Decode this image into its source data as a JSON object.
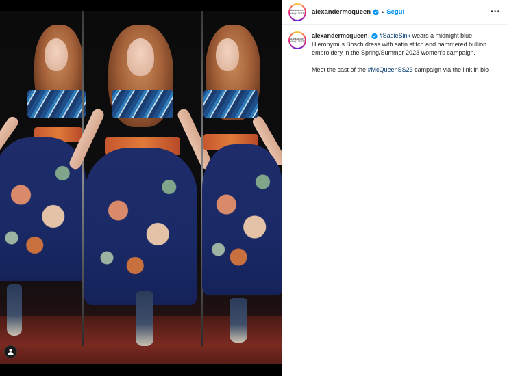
{
  "post": {
    "account": {
      "username": "alexandermcqueen",
      "avatar_text": "Alexander McQUEEN",
      "verified": true
    },
    "header": {
      "separator": "•",
      "follow_label": "Segui",
      "more_icon": "more-horizontal-icon"
    },
    "caption": {
      "username": "alexandermcqueen",
      "hashtag_1": "#SadieSink",
      "text_1": " wears a midnight blue Hieronymus Bosch dress with satin stitch and hammered bullion embroidery in the Spring/Summer 2023 women's campaign.",
      "text_2_before": "Meet the cast of the ",
      "hashtag_2": "#McQueenSS23",
      "text_2_after": " campaign via the link in bio"
    },
    "media": {
      "tag_icon": "user-tag-icon"
    },
    "colors": {
      "accent": "#0095f6",
      "hashtag": "#00376b",
      "text": "#262626"
    }
  }
}
